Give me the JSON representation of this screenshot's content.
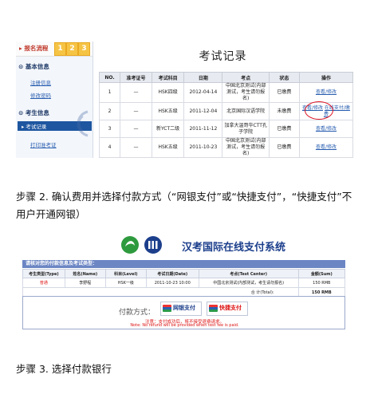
{
  "exam_records": {
    "progress_label": "报名流程",
    "progress_steps": [
      "1",
      "2",
      "3"
    ],
    "sections": [
      {
        "title": "基本信息",
        "links": [
          "注册信息",
          "修改密码"
        ]
      },
      {
        "title": "考生信息",
        "active_item": "考试记录",
        "links": [
          "打印准考证"
        ]
      }
    ],
    "page_title": "考试记录",
    "columns": [
      "NO.",
      "准考证号",
      "考试科目",
      "日期",
      "考点",
      "状态",
      "操作"
    ],
    "rows": [
      {
        "no": "1",
        "ticket": "—",
        "subject": "HSK四级",
        "date": "2012-04-14",
        "site": "中国北京测试(内部测试，考生请勿报名)",
        "status": "已缴费",
        "actions": [
          "查看/修改"
        ]
      },
      {
        "no": "2",
        "ticket": "—",
        "subject": "HSK五级",
        "date": "2011-12-04",
        "site": "北京国际汉语学院",
        "status": "未缴费",
        "actions": [
          "查看/修改",
          "在线支付/缴费"
        ]
      },
      {
        "no": "3",
        "ticket": "—",
        "subject": "新YCT二级",
        "date": "2011-11-12",
        "site": "加拿大温哥华CTT孔子学院",
        "status": "已缴费",
        "actions": [
          "查看/修改"
        ]
      },
      {
        "no": "4",
        "ticket": "—",
        "subject": "HSK五级",
        "date": "2011-10-23",
        "site": "中国北京测试(内部测试，考生请勿报名)",
        "status": "已缴费",
        "actions": [
          "查看/修改"
        ]
      }
    ]
  },
  "step2_text": "步骤 2. 确认费用并选择付款方式（“网银支付”或“快捷支付”，“快捷支付”不用户开通网银）",
  "payment": {
    "system_title": "汉考国际在线支付系统",
    "confirm_header": "请核对您的付款信息及考试类型：",
    "columns": [
      "考生类型(Type)",
      "姓名(Name)",
      "科目(Level)",
      "考试日期(Date)",
      "考点(Test Center)",
      "金额(Sum)"
    ],
    "row": {
      "type": "普通",
      "name": "李野程",
      "level": "HSK一级",
      "date": "2011-10-23 10:00",
      "center": "中国北京测试(内部测试，考生请勿报名)",
      "sum": "150 RMB"
    },
    "total_label": "合 计(Total):",
    "total_value": "150 RMB",
    "method_label": "付款方式：",
    "bank_button": "网银支付",
    "quick_button": "快捷支付",
    "warning_cn": "注意：支付成功后，将不接受退费请求。",
    "warning_en": "Note: No refund will be provided when test fee is paid.",
    "colors": {
      "header_bg": "#6c86c4",
      "title": "#1c3f8c",
      "warning": "#dd1111"
    }
  },
  "step3_text": "步骤 3. 选择付款银行"
}
